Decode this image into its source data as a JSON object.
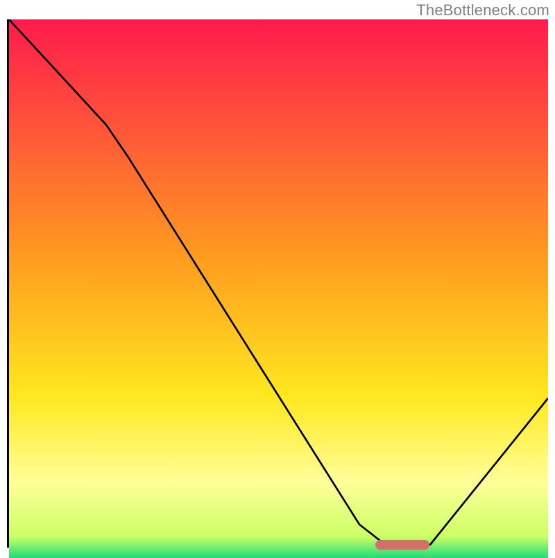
{
  "watermark": "TheBottleneck.com",
  "chart_data": {
    "type": "line",
    "title": "",
    "xlabel": "",
    "ylabel": "",
    "xlim": [
      0,
      100
    ],
    "ylim": [
      0,
      100
    ],
    "gradient_stops": [
      {
        "pos": 0,
        "color": "#ff1a4d"
      },
      {
        "pos": 45,
        "color": "#ff9e1f"
      },
      {
        "pos": 70,
        "color": "#ffe81f"
      },
      {
        "pos": 86,
        "color": "#ffff99"
      },
      {
        "pos": 96,
        "color": "#ccff66"
      },
      {
        "pos": 100,
        "color": "#1fdd7a"
      }
    ],
    "curve": [
      {
        "x": 0,
        "y": 100
      },
      {
        "x": 18,
        "y": 80
      },
      {
        "x": 22,
        "y": 74
      },
      {
        "x": 65,
        "y": 4
      },
      {
        "x": 70,
        "y": 0
      },
      {
        "x": 78,
        "y": 0
      },
      {
        "x": 100,
        "y": 28
      }
    ],
    "marker": {
      "x_start": 68,
      "x_end": 78,
      "y": 0,
      "color": "#d66f6c"
    }
  }
}
